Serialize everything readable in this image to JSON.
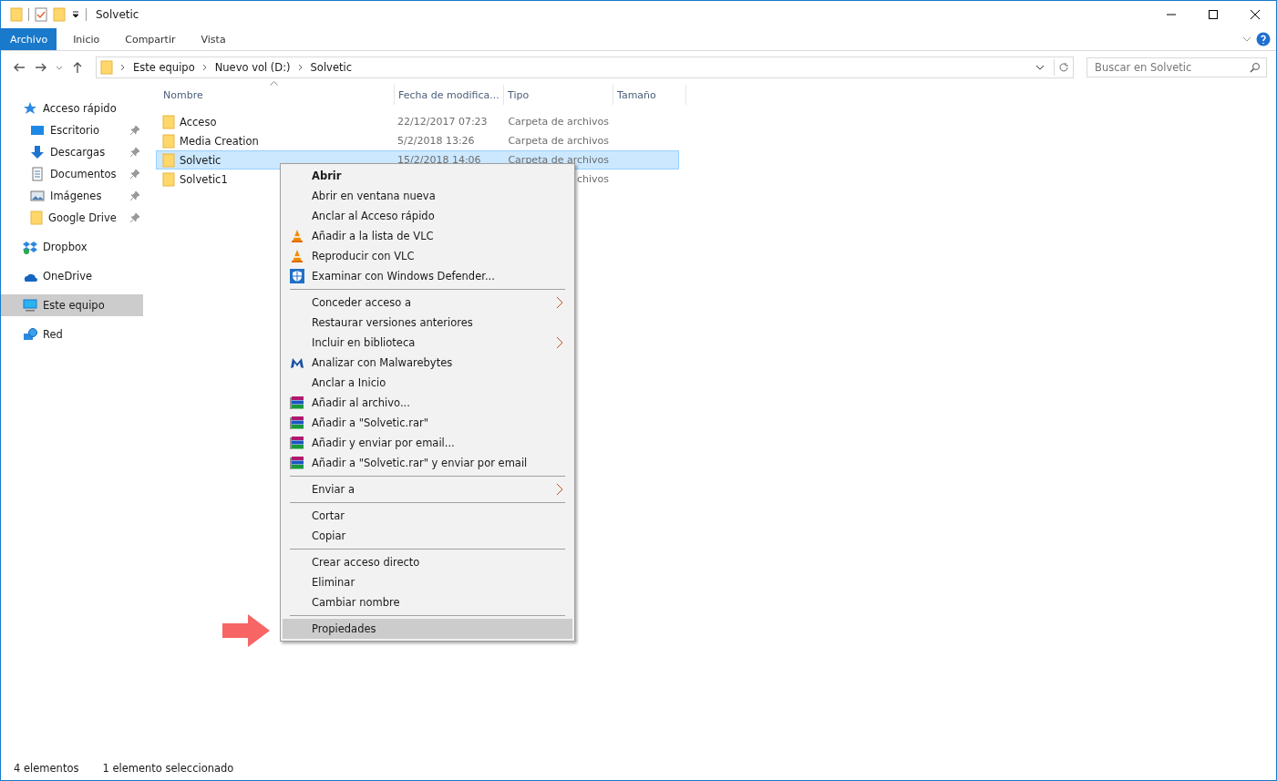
{
  "window": {
    "title": "Solvetic"
  },
  "ribbon_tabs": [
    {
      "label": "Archivo",
      "selected": true
    },
    {
      "label": "Inicio",
      "selected": false
    },
    {
      "label": "Compartir",
      "selected": false
    },
    {
      "label": "Vista",
      "selected": false
    }
  ],
  "address": {
    "crumbs": [
      "Este equipo",
      "Nuevo vol (D:)",
      "Solvetic"
    ]
  },
  "search": {
    "placeholder": "Buscar en Solvetic"
  },
  "sidebar": {
    "items": [
      {
        "label": "Acceso rápido",
        "selected": false,
        "children": [
          {
            "label": "Escritorio",
            "pinned": true
          },
          {
            "label": "Descargas",
            "pinned": true
          },
          {
            "label": "Documentos",
            "pinned": true
          },
          {
            "label": "Imágenes",
            "pinned": true
          },
          {
            "label": "Google Drive",
            "pinned": true
          }
        ]
      },
      {
        "label": "Dropbox",
        "selected": false
      },
      {
        "label": "OneDrive",
        "selected": false
      },
      {
        "label": "Este equipo",
        "selected": true
      },
      {
        "label": "Red",
        "selected": false
      }
    ]
  },
  "table": {
    "columns": [
      "Nombre",
      "Fecha de modifica...",
      "Tipo",
      "Tamaño"
    ],
    "rows": [
      {
        "name": "Acceso",
        "date": "22/12/2017 07:23",
        "type": "Carpeta de archivos",
        "selected": false
      },
      {
        "name": "Media Creation",
        "date": "5/2/2018 13:26",
        "type": "Carpeta de archivos",
        "selected": false
      },
      {
        "name": "Solvetic",
        "date": "15/2/2018 14:06",
        "type": "Carpeta de archivos",
        "selected": true
      },
      {
        "name": "Solvetic1",
        "type": "chivos",
        "selected": false
      }
    ]
  },
  "context_menu": {
    "items": [
      {
        "kind": "plain",
        "label": "Abrir",
        "bold": true
      },
      {
        "kind": "plain",
        "label": "Abrir en ventana nueva"
      },
      {
        "kind": "plain",
        "label": "Anclar al Acceso rápido"
      },
      {
        "kind": "cone",
        "label": "Añadir a la lista de VLC"
      },
      {
        "kind": "cone",
        "label": "Reproducir con VLC"
      },
      {
        "kind": "shield",
        "label": "Examinar con Windows Defender..."
      },
      {
        "kind": "separator"
      },
      {
        "kind": "plain",
        "label": "Conceder acceso a",
        "submenu": true
      },
      {
        "kind": "plain",
        "label": "Restaurar versiones anteriores"
      },
      {
        "kind": "plain",
        "label": "Incluir en biblioteca",
        "submenu": true
      },
      {
        "kind": "mlogo",
        "label": "Analizar con Malwarebytes"
      },
      {
        "kind": "plain",
        "label": "Anclar a Inicio"
      },
      {
        "kind": "books",
        "label": "Añadir al archivo..."
      },
      {
        "kind": "books",
        "label": "Añadir a \"Solvetic.rar\""
      },
      {
        "kind": "books",
        "label": "Añadir y enviar por email..."
      },
      {
        "kind": "books",
        "label": "Añadir a \"Solvetic.rar\" y enviar por email"
      },
      {
        "kind": "separator"
      },
      {
        "kind": "plain",
        "label": "Enviar a",
        "submenu": true
      },
      {
        "kind": "separator"
      },
      {
        "kind": "plain",
        "label": "Cortar"
      },
      {
        "kind": "plain",
        "label": "Copiar"
      },
      {
        "kind": "separator"
      },
      {
        "kind": "plain",
        "label": "Crear acceso directo"
      },
      {
        "kind": "plain",
        "label": "Eliminar"
      },
      {
        "kind": "plain",
        "label": "Cambiar nombre"
      },
      {
        "kind": "separator"
      },
      {
        "kind": "plain",
        "label": "Propiedades",
        "selected": true
      }
    ]
  },
  "status_bar": {
    "count": "4 elementos",
    "selection": "1 elemento seleccionado"
  }
}
